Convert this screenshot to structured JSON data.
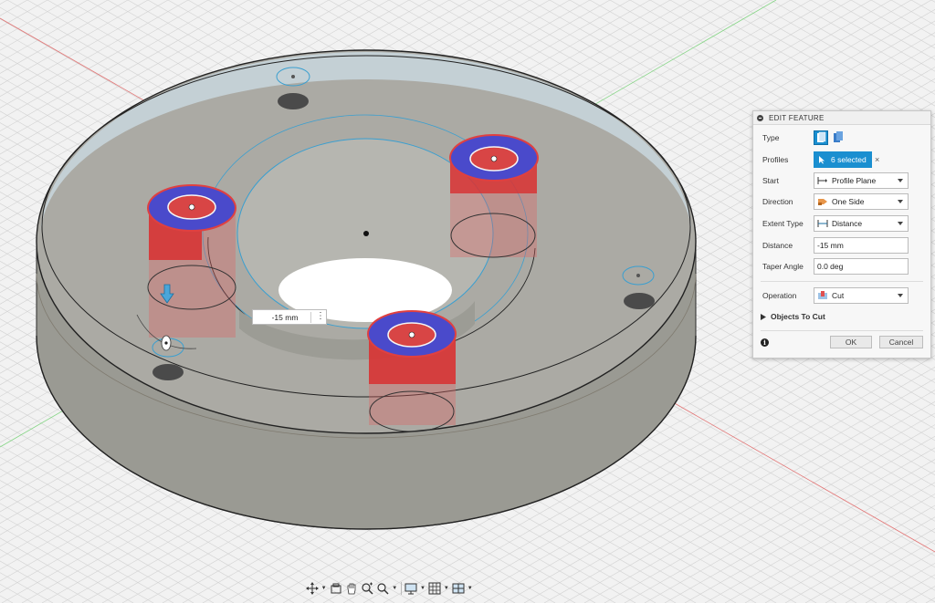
{
  "dialog": {
    "title": "EDIT FEATURE",
    "type_label": "Type",
    "profiles_label": "Profiles",
    "profiles_value": "6 selected",
    "profiles_clear": "×",
    "start_label": "Start",
    "start_value": "Profile Plane",
    "direction_label": "Direction",
    "direction_value": "One Side",
    "extent_label": "Extent Type",
    "extent_value": "Distance",
    "distance_label": "Distance",
    "distance_value": "-15 mm",
    "taper_label": "Taper Angle",
    "taper_value": "0.0 deg",
    "operation_label": "Operation",
    "operation_value": "Cut",
    "objects_to_cut": "Objects To Cut",
    "ok_label": "OK",
    "cancel_label": "Cancel",
    "info_icon": "i"
  },
  "viewport": {
    "dimension_value": "-15 mm",
    "dimension_menu": "⋮",
    "colors": {
      "background": "#f2f2f2",
      "body_top": "#a9a9a4",
      "body_side": "#9a9a93",
      "glass": "#d4e3ec",
      "cut_red": "#e03030",
      "cut_blue": "#4a4ac8",
      "sketch_line": "#3a9fd0",
      "accent": "#1a8fd0"
    }
  },
  "toolbar": {
    "icons": [
      "orbit-icon",
      "look-at-icon",
      "pan-icon",
      "zoom-icon",
      "zoom-window-icon",
      "display-settings-icon",
      "grid-icon",
      "viewports-icon"
    ]
  }
}
